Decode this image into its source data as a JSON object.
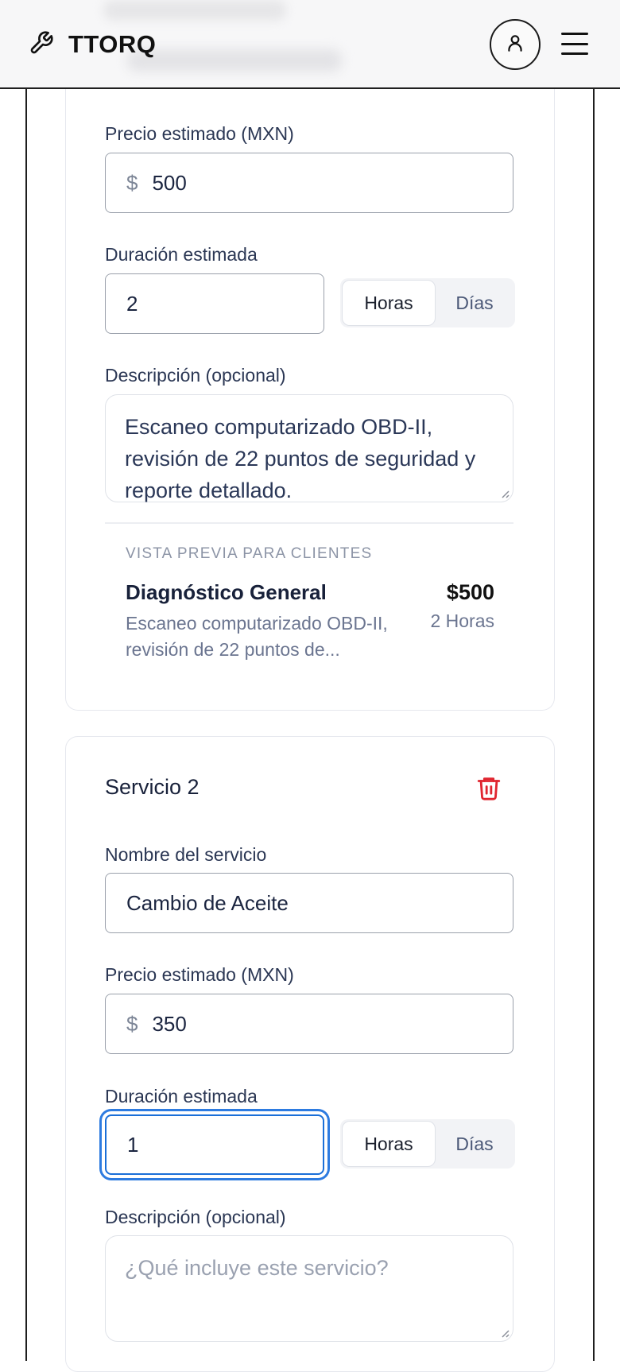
{
  "header": {
    "brand": "TTORQ",
    "icons": {
      "logo": "wrench-icon",
      "account": "user-icon",
      "menu": "hamburger-icon"
    }
  },
  "service1": {
    "price_label": "Precio estimado (MXN)",
    "currency_symbol": "$",
    "price_value": "500",
    "duration_label": "Duración estimada",
    "duration_value": "2",
    "unit_hours": "Horas",
    "unit_days": "Días",
    "selected_unit": "Horas",
    "description_label": "Descripción (opcional)",
    "description_value": "Escaneo computarizado OBD-II, revisión de 22 puntos de seguridad y reporte detallado.",
    "preview": {
      "label": "VISTA PREVIA PARA CLIENTES",
      "name": "Diagnóstico General",
      "price": "$500",
      "description": "Escaneo computarizado OBD-II, revisión de 22 puntos de...",
      "duration": "2 Horas"
    }
  },
  "service2": {
    "title": "Servicio 2",
    "delete_icon": "trash-icon",
    "name_label": "Nombre del servicio",
    "name_value": "Cambio de Aceite",
    "price_label": "Precio estimado (MXN)",
    "currency_symbol": "$",
    "price_value": "350",
    "duration_label": "Duración estimada",
    "duration_value": "1",
    "unit_hours": "Horas",
    "unit_days": "Días",
    "selected_unit": "Horas",
    "description_label": "Descripción (opcional)",
    "description_placeholder": "¿Qué incluye este servicio?"
  },
  "colors": {
    "accent_focus": "#1a6fd8",
    "delete_red": "#e0252f",
    "text_primary": "#18213a"
  }
}
